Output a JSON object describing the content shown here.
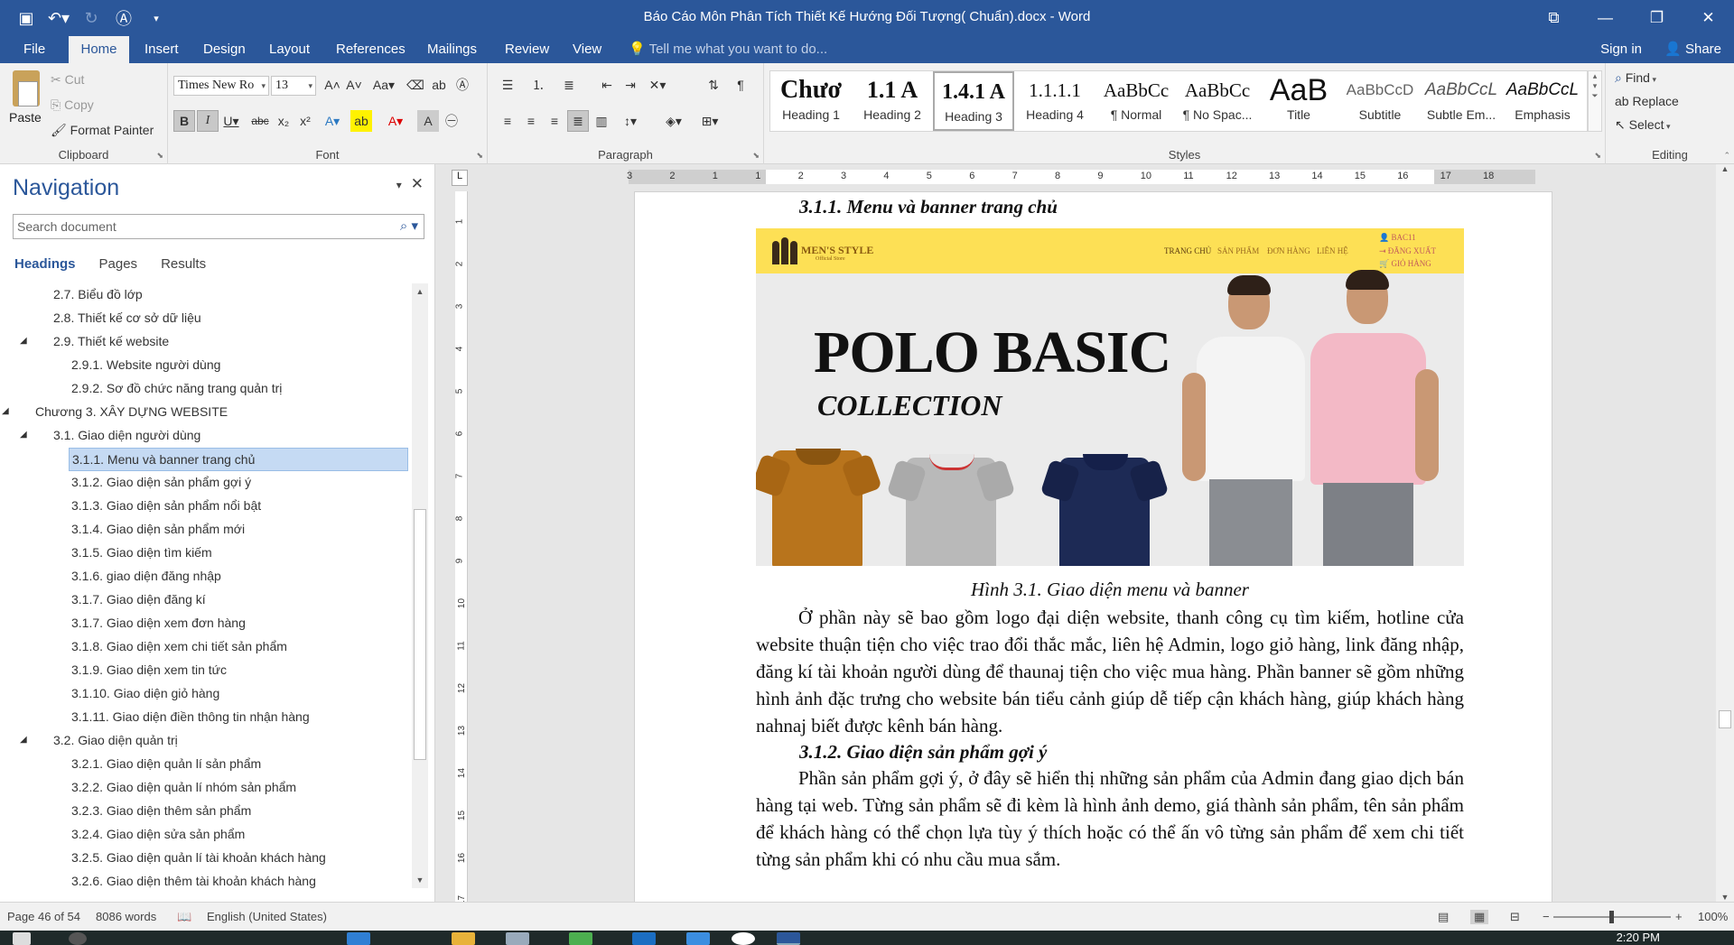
{
  "window": {
    "title": "Báo Cáo Môn Phân Tích Thiết Kế Hướng Đối Tượng( Chuẩn).docx - Word"
  },
  "ribbon_tabs": [
    "File",
    "Home",
    "Insert",
    "Design",
    "Layout",
    "References",
    "Mailings",
    "Review",
    "View"
  ],
  "tell_me": "Tell me what you want to do...",
  "sign_in": "Sign in",
  "share": "Share",
  "clipboard": {
    "paste": "Paste",
    "cut": "Cut",
    "copy": "Copy",
    "format_painter": "Format Painter",
    "label": "Clipboard"
  },
  "font": {
    "name": "Times New Ro",
    "size": "13",
    "label": "Font"
  },
  "paragraph": {
    "label": "Paragraph"
  },
  "styles": {
    "label": "Styles",
    "items": [
      {
        "preview": "Chươ",
        "name": "Heading 1"
      },
      {
        "preview": "1.1  A",
        "name": "Heading 2"
      },
      {
        "preview": "1.4.1  A",
        "name": "Heading 3"
      },
      {
        "preview": "1.1.1.1",
        "name": "Heading 4"
      },
      {
        "preview": "AaBbCc",
        "name": "¶ Normal"
      },
      {
        "preview": "AaBbCc",
        "name": "¶ No Spac..."
      },
      {
        "preview": "AaB",
        "name": "Title"
      },
      {
        "preview": "AaBbCcD",
        "name": "Subtitle"
      },
      {
        "preview": "AaBbCcL",
        "name": "Subtle Em..."
      },
      {
        "preview": "AaBbCcL",
        "name": "Emphasis"
      }
    ]
  },
  "editing": {
    "find": "Find",
    "replace": "Replace",
    "select": "Select",
    "label": "Editing"
  },
  "navigation": {
    "title": "Navigation",
    "search_placeholder": "Search document",
    "tabs": [
      "Headings",
      "Pages",
      "Results"
    ],
    "items": [
      {
        "text": "2.7. Biểu đồ lớp",
        "level": 2
      },
      {
        "text": "2.8. Thiết kế cơ sở dữ liệu",
        "level": 2
      },
      {
        "text": "2.9. Thiết kế website",
        "level": 2,
        "expanded": true
      },
      {
        "text": "2.9.1. Website người dùng",
        "level": 3
      },
      {
        "text": "2.9.2. Sơ đồ chức năng trang quản trị",
        "level": 3
      },
      {
        "text": "Chương 3. XÂY DỰNG WEBSITE",
        "level": 1,
        "expanded": true
      },
      {
        "text": "3.1. Giao diện người dùng",
        "level": 2,
        "expanded": true
      },
      {
        "text": "3.1.1. Menu và banner trang chủ",
        "level": 3,
        "selected": true
      },
      {
        "text": "3.1.2. Giao diện sản phẩm gợi ý",
        "level": 3
      },
      {
        "text": "3.1.3. Giao diện sản phẩm nổi bật",
        "level": 3
      },
      {
        "text": "3.1.4. Giao diện sản phẩm mới",
        "level": 3
      },
      {
        "text": "3.1.5. Giao diện tìm kiếm",
        "level": 3
      },
      {
        "text": "3.1.6. giao diện đăng nhập",
        "level": 3
      },
      {
        "text": "3.1.7. Giao diện đăng kí",
        "level": 3
      },
      {
        "text": "3.1.7. Giao diện xem đơn hàng",
        "level": 3
      },
      {
        "text": "3.1.8. Giao diện xem chi tiết sản phẩm",
        "level": 3
      },
      {
        "text": "3.1.9. Giao diện xem tin tức",
        "level": 3
      },
      {
        "text": "3.1.10. Giao diện giỏ hàng",
        "level": 3
      },
      {
        "text": "3.1.11. Giao diện điền thông tin nhận hàng",
        "level": 3
      },
      {
        "text": "3.2. Giao diện quản trị",
        "level": 2,
        "expanded": true
      },
      {
        "text": "3.2.1. Giao diện quản lí sản phẩm",
        "level": 3
      },
      {
        "text": "3.2.2. Giao diện quản lí nhóm sản phẩm",
        "level": 3
      },
      {
        "text": "3.2.3. Giao diện thêm sản phẩm",
        "level": 3
      },
      {
        "text": "3.2.4. Giao diện sửa sản phẩm",
        "level": 3
      },
      {
        "text": " 3.2.5. Giao diện quản lí tài khoản khách hàng",
        "level": 3
      },
      {
        "text": "3.2.6. Giao diện thêm tài khoản khách hàng",
        "level": 3
      }
    ]
  },
  "ruler": {
    "ticks": [
      "3",
      "2",
      "1",
      "1",
      "2",
      "3",
      "4",
      "5",
      "6",
      "7",
      "8",
      "9",
      "10",
      "11",
      "12",
      "13",
      "14",
      "15",
      "16",
      "17",
      "18"
    ],
    "vticks": [
      "1",
      "2",
      "3",
      "4",
      "5",
      "6",
      "7",
      "8",
      "9",
      "10",
      "11",
      "12",
      "13",
      "14",
      "15",
      "16",
      "17"
    ]
  },
  "document": {
    "heading1": "3.1.1. Menu và banner trang chủ",
    "banner": {
      "brand": "MEN'S STYLE",
      "brand_sub": "Official Store",
      "menu": [
        "TRANG CHỦ",
        "SẢN PHẨM",
        "ĐƠN HÀNG",
        "LIÊN HỆ"
      ],
      "account": [
        "BAC11",
        "ĐĂNG XUẤT",
        "GIỎ HÀNG"
      ],
      "headline": "POLO BASIC",
      "subheadline": "COLLECTION"
    },
    "caption": "Hình 3.1. Giao diện menu và banner",
    "paragraph1": "Ở phần này sẽ bao gồm logo đại diện website, thanh công cụ tìm kiếm, hotline cửa website thuận tiện cho việc trao đổi thắc mắc, liên hệ Admin, logo giỏ hàng, link đăng nhập, đăng kí tài khoản người dùng để thaunaj tiện cho việc mua hàng. Phần banner sẽ gồm những hình ảnh đặc trưng cho website bán tiểu cảnh giúp dễ tiếp cận khách hàng, giúp khách hàng nahnaj biết được kênh bán hàng.",
    "heading2": "3.1.2. Giao diện sản phẩm gợi ý",
    "paragraph2": "Phần sản phẩm gợi ý, ở đây sẽ hiển thị những sản phẩm của Admin đang giao dịch bán hàng tại web. Từng sản phẩm sẽ đi kèm là hình ảnh demo, giá thành sản phẩm, tên sản phẩm để khách hàng có thể chọn lựa tùy ý thích hoặc có thể ấn vô từng sản phẩm để xem chi tiết từng sản phẩm khi có nhu cầu mua sắm."
  },
  "statusbar": {
    "page": "Page 46 of 54",
    "words": "8086 words",
    "language": "English (United States)",
    "zoom": "100%"
  },
  "taskbar": {
    "clock": "2:20 PM"
  },
  "colors": {
    "accent": "#2b579a",
    "banner_yellow": "#fde055",
    "selection": "#c5daf3"
  }
}
